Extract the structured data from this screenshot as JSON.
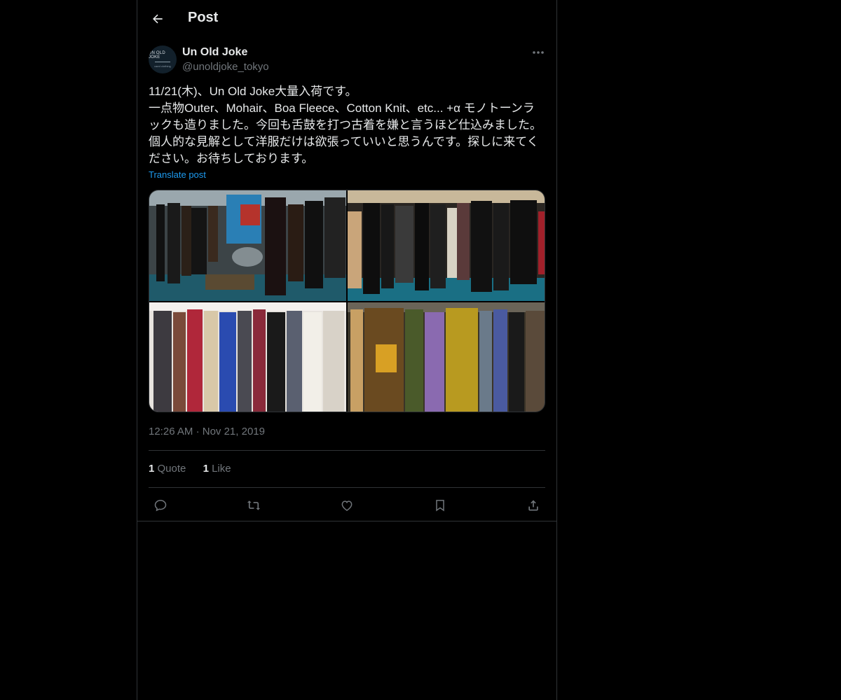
{
  "header": {
    "title": "Post",
    "back_icon": "arrow-left-icon"
  },
  "post": {
    "author_name": "Un Old Joke",
    "author_handle": "@unoldjoke_tokyo",
    "avatar_text": "UN OLD JOKE",
    "avatar_subtext": "used clothing",
    "text": "11/21(木)、Un Old Joke大量入荷です。\n一点物Outer、Mohair、Boa Fleece、Cotton Knit、etc... +α モノトーンラックも造りました。今回も舌鼓を打つ古着を嫌と言うほど仕込みました。個人的な見解として洋服だけは欲張っていいと思うんです。探しに来てください。お待ちしております。",
    "translate_label": "Translate post",
    "time": "12:26 AM",
    "separator": "·",
    "date": "Nov 21, 2019",
    "media": [
      {
        "label": "photo-rack-outer"
      },
      {
        "label": "photo-rack-monotone"
      },
      {
        "label": "photo-rack-knit"
      },
      {
        "label": "photo-rack-mohair"
      }
    ]
  },
  "stats": {
    "quote_count": "1",
    "quote_label": "Quote",
    "like_count": "1",
    "like_label": "Like"
  },
  "actions": [
    "reply-icon",
    "repost-icon",
    "like-icon",
    "bookmark-icon",
    "share-icon"
  ],
  "colors": {
    "background": "#000000",
    "text": "#e7e9ea",
    "secondary": "#71767b",
    "link": "#1d9bf0",
    "border": "#2f3336"
  }
}
